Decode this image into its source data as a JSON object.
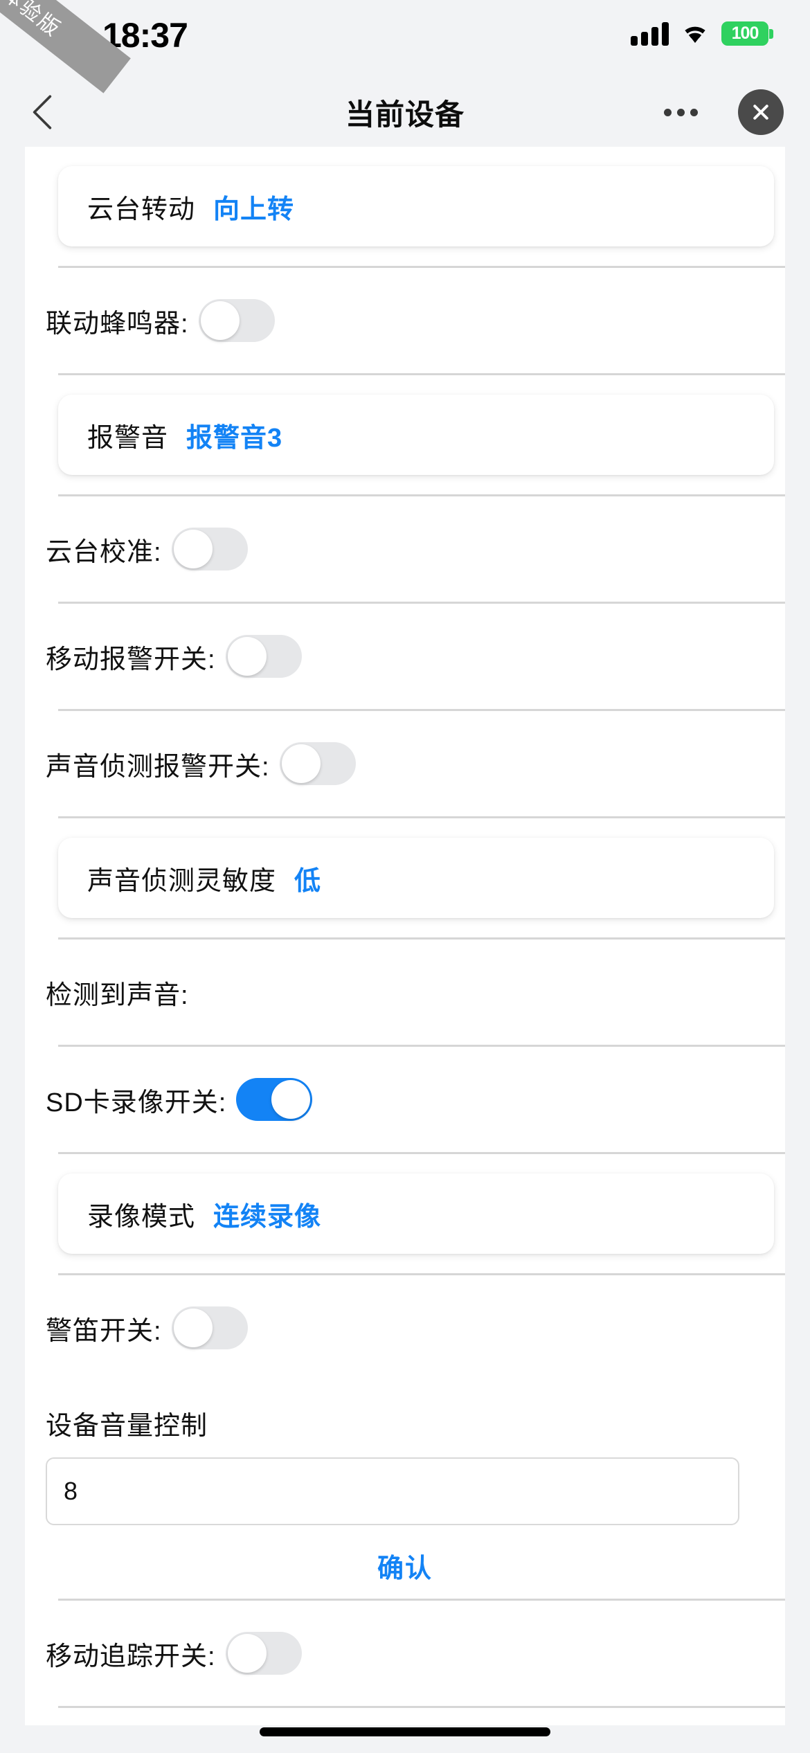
{
  "ribbon": {
    "text": "体验版"
  },
  "statusbar": {
    "time": "18:37",
    "battery_label": "100",
    "battery_color": "#2fd15f",
    "signal_icon": "signal-bars-icon",
    "wifi_icon": "wifi-icon"
  },
  "navbar": {
    "back_icon": "chevron-left-icon",
    "title": "当前设备",
    "more_icon": "more-dots-icon",
    "close_icon": "close-x-icon"
  },
  "theme": {
    "accent": "#1383f5",
    "divider": "#d6d6d6",
    "bg": "#f2f3f5"
  },
  "rows": [
    {
      "type": "card",
      "label": "云台转动",
      "value": "向上转"
    },
    {
      "type": "toggle",
      "label": "联动蜂鸣器:",
      "on": false
    },
    {
      "type": "card",
      "label": "报警音",
      "value": "报警音3"
    },
    {
      "type": "toggle",
      "label": "云台校准:",
      "on": false
    },
    {
      "type": "toggle",
      "label": "移动报警开关:",
      "on": false
    },
    {
      "type": "toggle",
      "label": "声音侦测报警开关:",
      "on": false
    },
    {
      "type": "card",
      "label": "声音侦测灵敏度",
      "value": "低"
    },
    {
      "type": "text",
      "label": "检测到声音:",
      "value": ""
    },
    {
      "type": "toggle",
      "label": "SD卡录像开关:",
      "on": true
    },
    {
      "type": "card",
      "label": "录像模式",
      "value": "连续录像"
    },
    {
      "type": "toggle",
      "label": "警笛开关:",
      "on": false
    }
  ],
  "volume": {
    "label": "设备音量控制",
    "value": "8",
    "placeholder": "",
    "confirm_label": "确认"
  },
  "last_row": {
    "label": "移动追踪开关:",
    "on": false
  }
}
